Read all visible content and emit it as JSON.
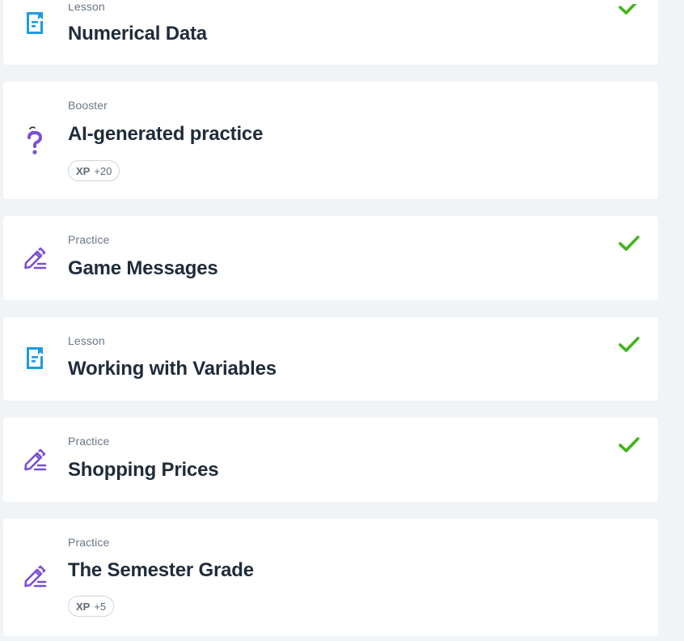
{
  "colors": {
    "lesson_icon": "#1e9be0",
    "practice_icon": "#7a4fd6",
    "booster_icon": "#7a4fd6",
    "check": "#3fb618",
    "title": "#1f2c3a",
    "label": "#6b7785"
  },
  "items": [
    {
      "type_label": "Lesson",
      "title": "Numerical Data",
      "icon": "lesson-book-icon",
      "completed": true
    },
    {
      "type_label": "Booster",
      "title": "AI-generated practice",
      "icon": "question-mark-icon",
      "xp_label": "XP",
      "xp_value": "+20",
      "completed": false
    },
    {
      "type_label": "Practice",
      "title": "Game Messages",
      "icon": "pencil-edit-icon",
      "completed": true
    },
    {
      "type_label": "Lesson",
      "title": "Working with Variables",
      "icon": "lesson-book-icon",
      "completed": true
    },
    {
      "type_label": "Practice",
      "title": "Shopping Prices",
      "icon": "pencil-edit-icon",
      "completed": true
    },
    {
      "type_label": "Practice",
      "title": "The Semester Grade",
      "icon": "pencil-edit-icon",
      "xp_label": "XP",
      "xp_value": "+5",
      "completed": false
    }
  ]
}
